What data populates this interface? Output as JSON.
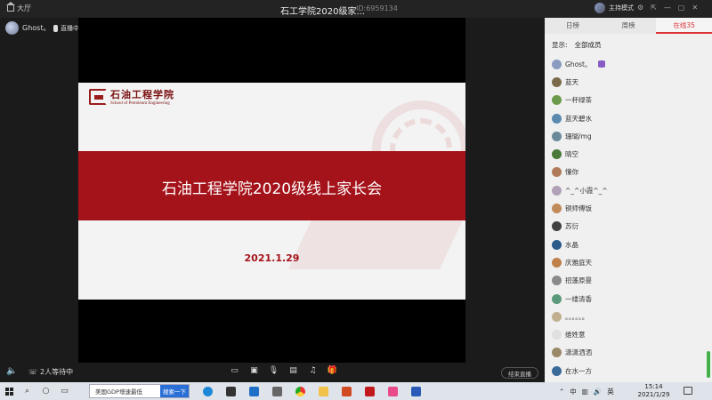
{
  "topbar": {
    "back_label": "大厅",
    "title": "石工学院2020级家...",
    "room_id": "ID:6959134",
    "host_mode": "主持模式"
  },
  "stage": {
    "presenter_name": "Ghost。",
    "live_label": "直播中"
  },
  "slide": {
    "logo_cn": "石油工程学院",
    "logo_en": "School of Petroleum Engineering",
    "title": "石油工程学院2020级线上家长会",
    "date": "2021.1.29"
  },
  "bottombar": {
    "waiting_text": "2人等待中",
    "end_label": "结束直播"
  },
  "panel": {
    "tabs": [
      {
        "label": "日榜",
        "active": false
      },
      {
        "label": "周榜",
        "active": false
      },
      {
        "label": "在线35",
        "active": true
      }
    ],
    "filter_label": "显示:",
    "filter_value": "全部成员",
    "members": [
      {
        "name": "Ghost。",
        "color": "#8a9ac0",
        "badge": true
      },
      {
        "name": "蓝天",
        "color": "#7a6a4a"
      },
      {
        "name": "一杯绿茶",
        "color": "#6a9a4a"
      },
      {
        "name": "蓝天碧水",
        "color": "#5a8ab0"
      },
      {
        "name": "珊瑚/mg",
        "color": "#6a8a9a"
      },
      {
        "name": "晴空",
        "color": "#4a7a3a"
      },
      {
        "name": "懂你",
        "color": "#b07a5a"
      },
      {
        "name": "^_^小霞^_^",
        "color": "#b0a0b8"
      },
      {
        "name": "铜师傅饭",
        "color": "#c08a5a"
      },
      {
        "name": "苏衍",
        "color": "#404040"
      },
      {
        "name": "水晶",
        "color": "#2a5a8a"
      },
      {
        "name": "庆雅庭天",
        "color": "#c0804a"
      },
      {
        "name": "招蓬原曼",
        "color": "#8a8a8a"
      },
      {
        "name": "一缕清香",
        "color": "#5a9a7a"
      },
      {
        "name": "。。。。。。",
        "color": "#c0b090"
      },
      {
        "name": "维姓意",
        "color": "#e0e0e0"
      },
      {
        "name": "潇潇洒洒",
        "color": "#9a8a6a"
      },
      {
        "name": "在水一方",
        "color": "#3a6a9a"
      }
    ]
  },
  "taskbar": {
    "search_text": "美国GDP增速最低",
    "search_button": "搜索一下",
    "ime": "中",
    "time": "15:14",
    "date": "2021/1/29"
  }
}
